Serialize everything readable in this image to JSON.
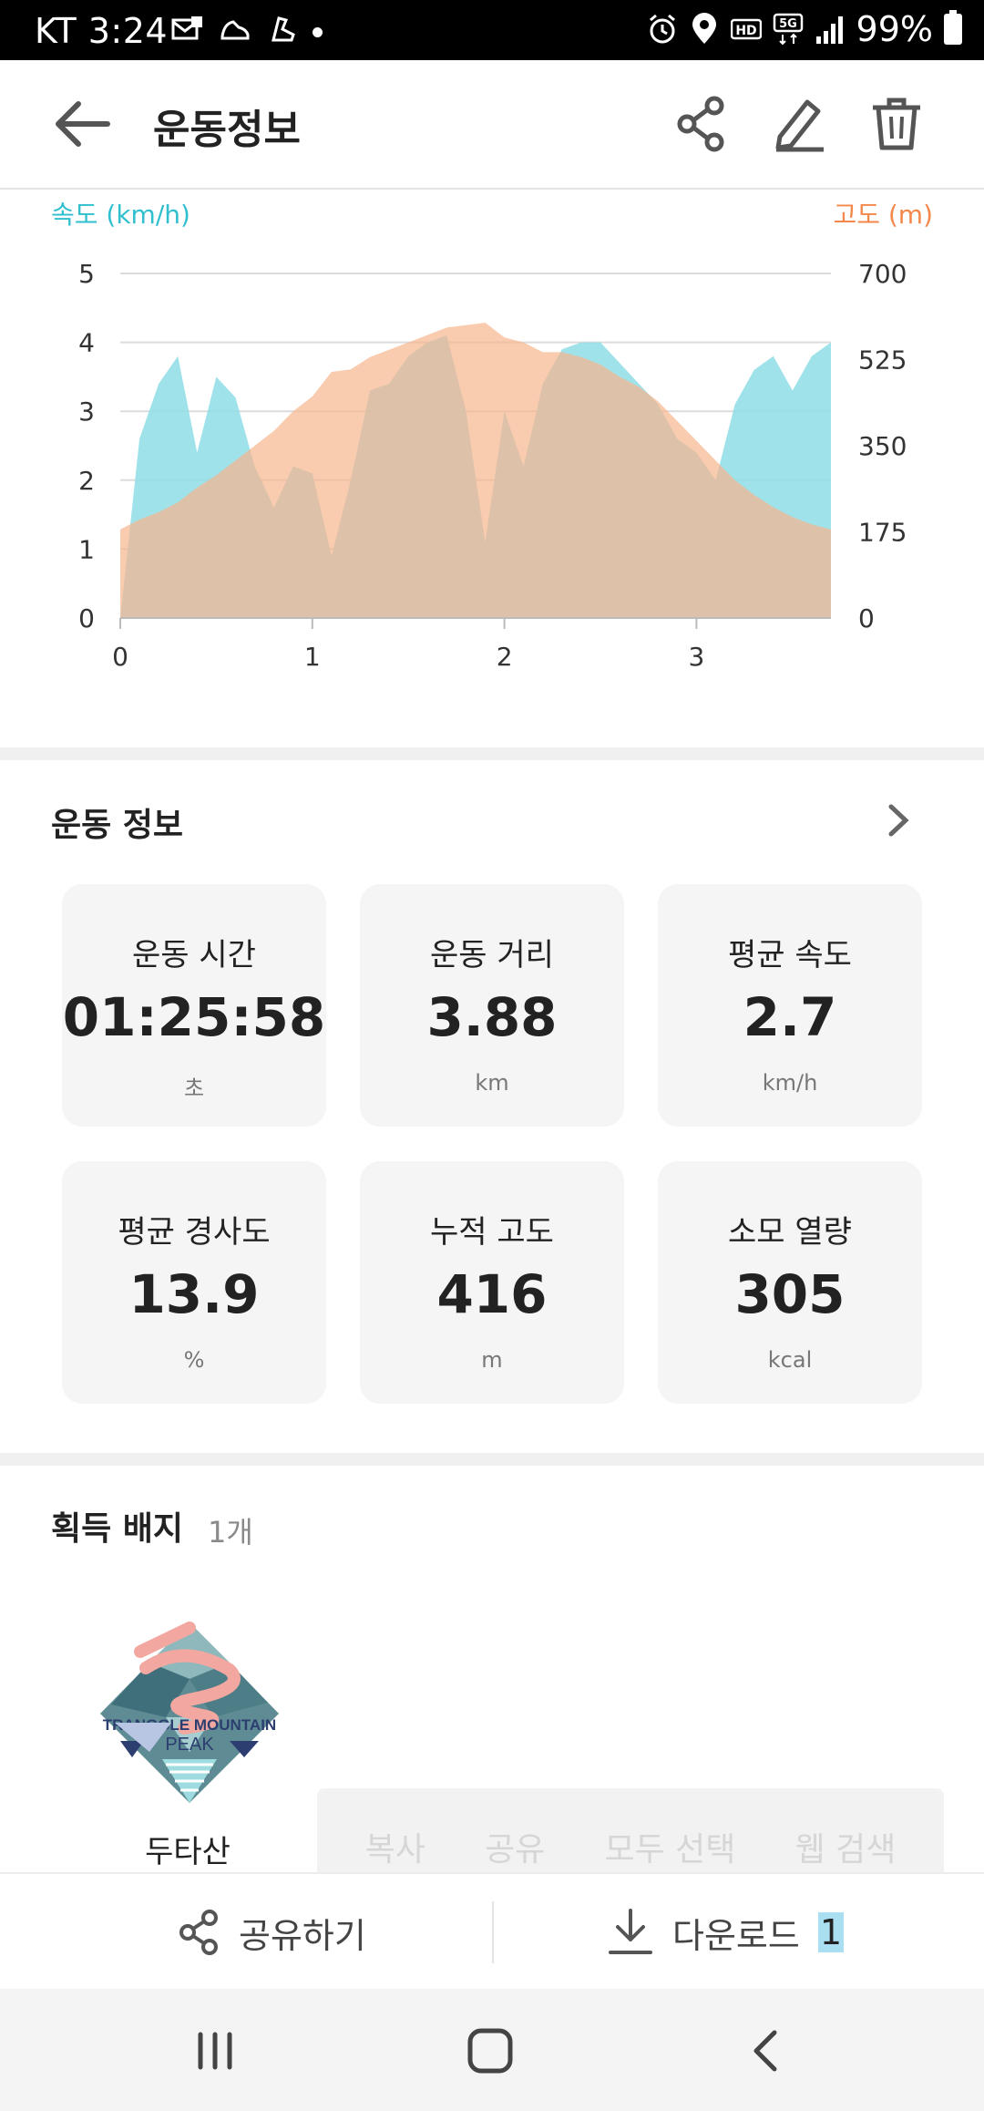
{
  "status_bar": {
    "carrier_time": "KT 3:24",
    "battery_percent": "99%",
    "icons_left": [
      "mail-notification-icon",
      "shoe-icon",
      "running-shoe-icon"
    ],
    "icons_right": [
      "alarm-icon",
      "location-icon",
      "hd-icon",
      "5g-icon",
      "signal-icon",
      "battery-icon"
    ]
  },
  "app_bar": {
    "title": "운동정보",
    "actions": [
      "share-icon",
      "edit-icon",
      "delete-icon"
    ]
  },
  "chart_data": {
    "type": "area",
    "left_axis_label": "속도 (km/h)",
    "right_axis_label": "고도 (m)",
    "xlim": [
      0,
      3.7
    ],
    "x_ticks": [
      0,
      1,
      2,
      3
    ],
    "ylim_left": [
      0,
      5
    ],
    "y_ticks_left": [
      0,
      1,
      2,
      3,
      4,
      5
    ],
    "ylim_right": [
      0,
      700
    ],
    "y_ticks_right": [
      0,
      175,
      350,
      525,
      700
    ],
    "grid": true,
    "series": [
      {
        "axis": "left",
        "color": "#8fdde6",
        "x": [
          0,
          0.1,
          0.2,
          0.3,
          0.4,
          0.5,
          0.6,
          0.7,
          0.8,
          0.9,
          1.0,
          1.1,
          1.2,
          1.3,
          1.4,
          1.5,
          1.6,
          1.7,
          1.8,
          1.9,
          2.0,
          2.1,
          2.2,
          2.3,
          2.4,
          2.5,
          2.6,
          2.7,
          2.8,
          2.9,
          3.0,
          3.1,
          3.2,
          3.3,
          3.4,
          3.5,
          3.6,
          3.7
        ],
        "values": [
          0,
          2.6,
          3.4,
          3.8,
          2.4,
          3.5,
          3.2,
          2.2,
          1.6,
          2.2,
          2.1,
          0.9,
          2.0,
          3.3,
          3.4,
          3.8,
          4.0,
          4.1,
          3.0,
          1.1,
          3.0,
          2.2,
          3.4,
          3.9,
          4.0,
          4.0,
          3.7,
          3.4,
          3.1,
          2.6,
          2.4,
          2.0,
          3.1,
          3.6,
          3.8,
          3.3,
          3.8,
          4.0
        ]
      },
      {
        "axis": "right",
        "color": "#f6b58d",
        "x": [
          0,
          0.1,
          0.2,
          0.3,
          0.4,
          0.5,
          0.6,
          0.7,
          0.8,
          0.9,
          1.0,
          1.1,
          1.2,
          1.3,
          1.4,
          1.5,
          1.6,
          1.7,
          1.8,
          1.9,
          2.0,
          2.1,
          2.2,
          2.3,
          2.4,
          2.5,
          2.6,
          2.7,
          2.8,
          2.9,
          3.0,
          3.1,
          3.2,
          3.3,
          3.4,
          3.5,
          3.6,
          3.7
        ],
        "values": [
          180,
          200,
          215,
          235,
          265,
          290,
          320,
          350,
          380,
          420,
          450,
          500,
          505,
          530,
          545,
          560,
          575,
          590,
          595,
          600,
          570,
          560,
          540,
          540,
          530,
          515,
          490,
          470,
          440,
          400,
          360,
          320,
          280,
          250,
          225,
          205,
          190,
          180
        ]
      }
    ]
  },
  "workout": {
    "section_title": "운동 정보",
    "stats": [
      {
        "label": "운동 시간",
        "value": "01:25:58",
        "unit": "초"
      },
      {
        "label": "운동 거리",
        "value": "3.88",
        "unit": "km"
      },
      {
        "label": "평균 속도",
        "value": "2.7",
        "unit": "km/h"
      },
      {
        "label": "평균 경사도",
        "value": "13.9",
        "unit": "%"
      },
      {
        "label": "누적 고도",
        "value": "416",
        "unit": "m"
      },
      {
        "label": "소모 열량",
        "value": "305",
        "unit": "kcal"
      }
    ]
  },
  "badges": {
    "section_title": "획득 배지",
    "count": "1개",
    "items": [
      {
        "name": "두타산",
        "logo_text_line1": "TRANGGLE MOUNTAIN",
        "logo_text_line2": "PEAK"
      }
    ]
  },
  "selection_toolbar": {
    "items": [
      "복사",
      "공유",
      "모두 선택",
      "웹 검색"
    ]
  },
  "bottom_actions": {
    "share_label": "공유하기",
    "download_label": "다운로드",
    "selected_text": "1"
  },
  "nav_bar": {
    "buttons": [
      "recent-apps-icon",
      "home-icon",
      "back-icon"
    ]
  }
}
